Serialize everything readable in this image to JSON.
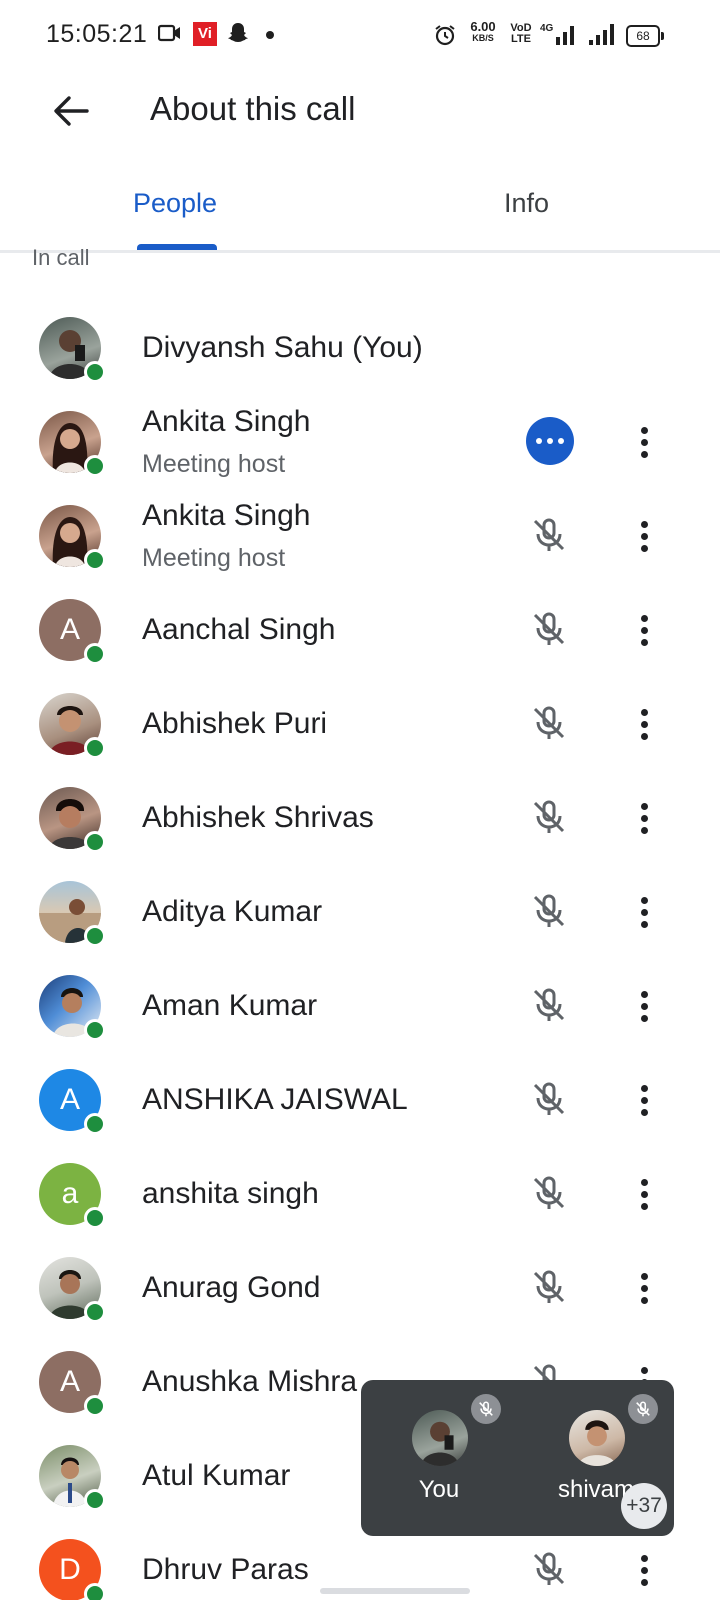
{
  "status_bar": {
    "time": "15:05:21",
    "carrier_badge": "Vi",
    "net_speed": "6.00",
    "net_speed_unit": "KB/S",
    "volte_top": "VoD",
    "volte_bottom": "LTE",
    "network": "4G",
    "battery": "68",
    "icons": [
      "video-camera-icon",
      "snapchat-icon",
      "alarm-icon",
      "signal-icon",
      "battery-icon"
    ]
  },
  "app_bar": {
    "back_icon": "arrow-back-icon",
    "title": "About this call"
  },
  "tabs": [
    {
      "label": "People",
      "selected": true
    },
    {
      "label": "Info",
      "selected": false
    }
  ],
  "section": {
    "header": "In call"
  },
  "participants": [
    {
      "name": "Divyansh Sahu (You)",
      "subtitle": "",
      "avatar": "photo",
      "status": "none"
    },
    {
      "name": "Ankita Singh",
      "subtitle": "Meeting host",
      "avatar": "photo",
      "status": "speaking"
    },
    {
      "name": "Ankita Singh",
      "subtitle": "Meeting host",
      "avatar": "photo",
      "status": "muted"
    },
    {
      "name": "Aanchal Singh",
      "subtitle": "",
      "avatar": "A",
      "avatar_color": "#8d6e63",
      "status": "muted"
    },
    {
      "name": "Abhishek Puri",
      "subtitle": "",
      "avatar": "photo",
      "status": "muted"
    },
    {
      "name": "Abhishek Shrivas",
      "subtitle": "",
      "avatar": "photo",
      "status": "muted"
    },
    {
      "name": "Aditya Kumar",
      "subtitle": "",
      "avatar": "photo",
      "status": "muted"
    },
    {
      "name": "Aman Kumar",
      "subtitle": "",
      "avatar": "photo",
      "status": "muted"
    },
    {
      "name": "ANSHIKA JAISWAL",
      "subtitle": "",
      "avatar": "A",
      "avatar_color": "#1e88e5",
      "status": "muted"
    },
    {
      "name": "anshita singh",
      "subtitle": "",
      "avatar": "a",
      "avatar_color": "#7cb342",
      "status": "muted"
    },
    {
      "name": "Anurag Gond",
      "subtitle": "",
      "avatar": "photo",
      "status": "muted"
    },
    {
      "name": "Anushka Mishra",
      "subtitle": "",
      "avatar": "A",
      "avatar_color": "#8d6e63",
      "status": "muted"
    },
    {
      "name": "Atul Kumar",
      "subtitle": "",
      "avatar": "photo",
      "status": "muted"
    },
    {
      "name": "Dhruv Paras",
      "subtitle": "",
      "avatar": "D",
      "avatar_color": "#f4511e",
      "status": "muted"
    }
  ],
  "pip": {
    "tiles": [
      {
        "label": "You",
        "muted": true
      },
      {
        "label": "shivam",
        "muted": true
      }
    ],
    "overflow": "+37"
  },
  "colors": {
    "accent": "#1a5cc8",
    "presence": "#1e8e3e",
    "pip_bg": "#3c4043"
  }
}
